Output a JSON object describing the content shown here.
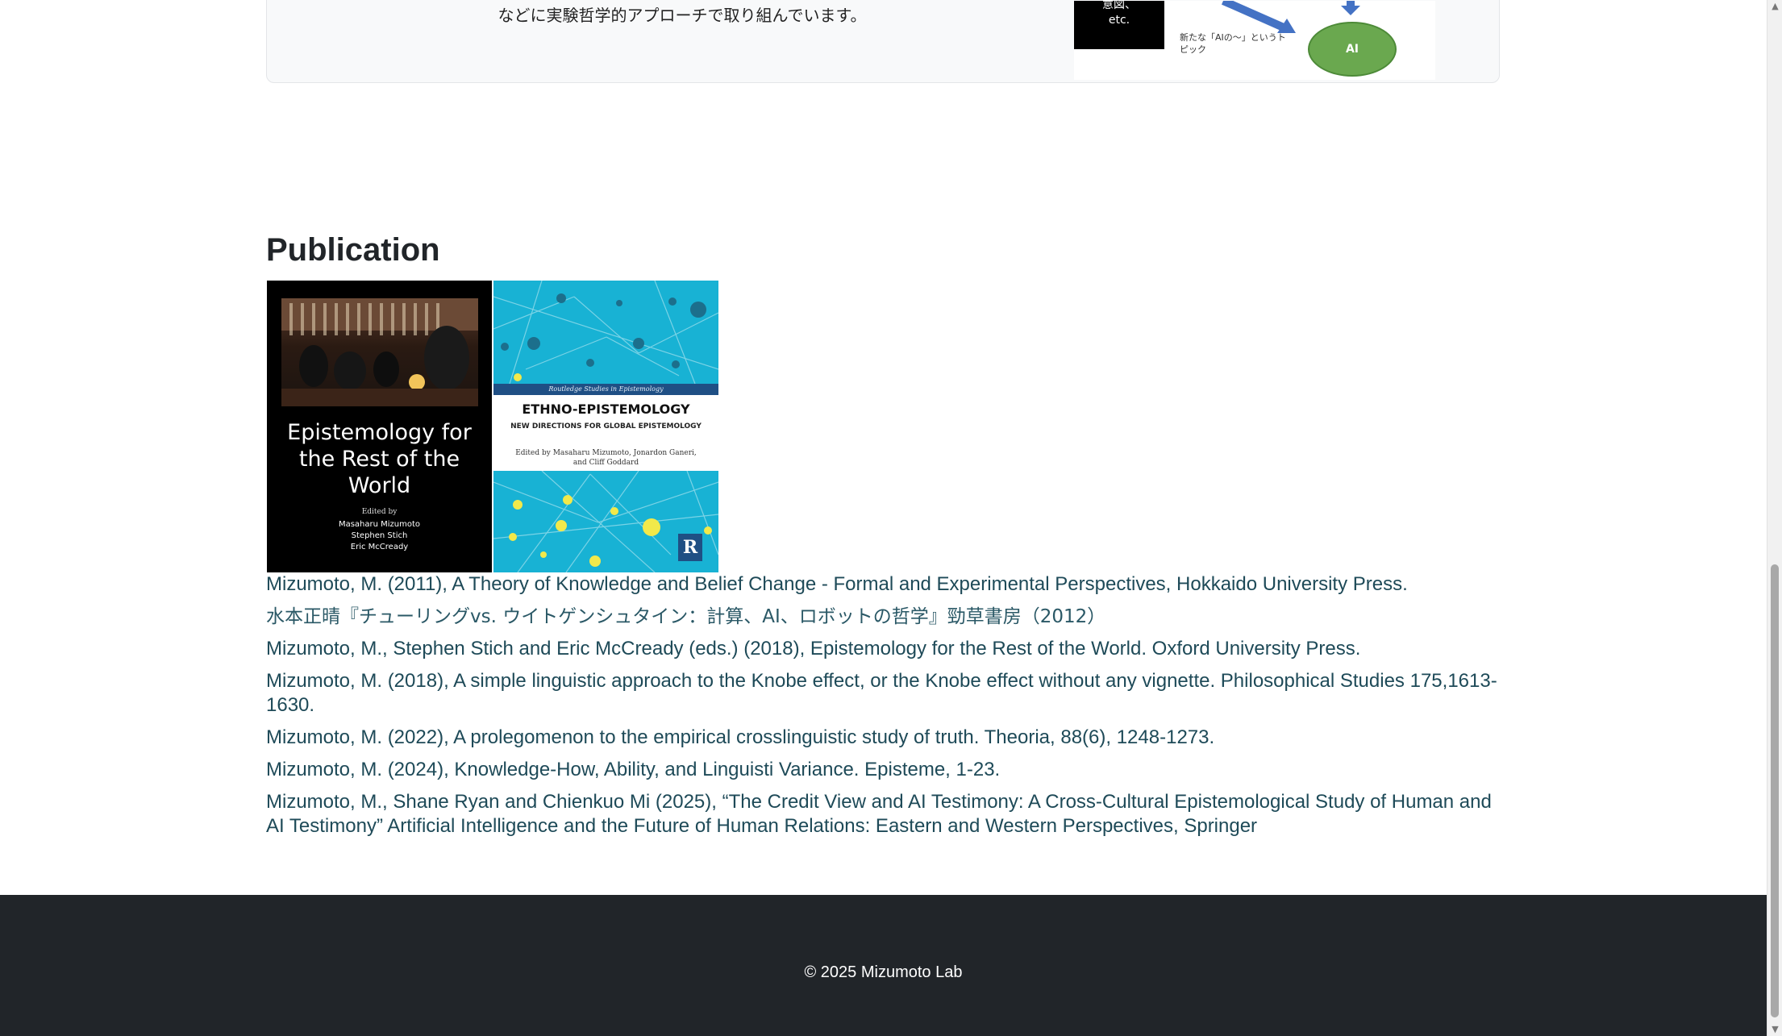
{
  "research": {
    "text": "などに実験哲学的アプローチで取り組んでいます。",
    "diagram": {
      "box_lines": [
        "意図、",
        "etc."
      ],
      "note": "新たな「AIの～」というトピック",
      "node_label": "AI",
      "colors": {
        "node": "#6aa84f",
        "arrow": "#4472c4"
      }
    }
  },
  "publication": {
    "title": "Publication",
    "covers": [
      {
        "title": "Epistemology for the Rest of the World",
        "edited_by": "Edited by",
        "editors": [
          "Masaharu Mizumoto",
          "Stephen Stich",
          "Eric McCready"
        ]
      },
      {
        "series": "Routledge Studies in Epistemology",
        "title": "ETHNO-EPISTEMOLOGY",
        "subtitle": "NEW DIRECTIONS FOR GLOBAL EPISTEMOLOGY",
        "editors": "Edited by Masaharu Mizumoto, Jonardon Ganeri, and Cliff Goddard",
        "publisher_mark": "R"
      }
    ],
    "items": [
      "Mizumoto, M. (2011), A Theory of Knowledge and Belief Change - Formal and Experimental Perspectives, Hokkaido University Press.",
      "水本正晴『チューリングvs. ウイトゲンシュタイン：計算、AI、ロボットの哲学』勁草書房（2012）",
      "Mizumoto, M., Stephen Stich and Eric McCready (eds.) (2018), Epistemology for the Rest of the World. Oxford University Press.",
      "Mizumoto, M. (2018), A simple linguistic approach to the Knobe effect, or the Knobe effect without any vignette. Philosophical Studies 175,1613-1630.",
      "Mizumoto, M. (2022), A prolegomenon to the empirical crosslinguistic study of truth. Theoria, 88(6), 1248-1273.",
      "Mizumoto, M. (2024), Knowledge-How, Ability, and Linguisti Variance. Episteme, 1-23.",
      "Mizumoto, M., Shane Ryan and Chienkuo Mi (2025), “The Credit View and AI Testimony: A Cross-Cultural Epistemological Study of Human and AI Testimony” Artificial Intelligence and the Future of Human Relations: Eastern and Western Perspectives, Springer"
    ]
  },
  "footer": {
    "text": "© 2025 Mizumoto Lab"
  },
  "scrollbar": {
    "up": "▲",
    "down": "▼"
  }
}
